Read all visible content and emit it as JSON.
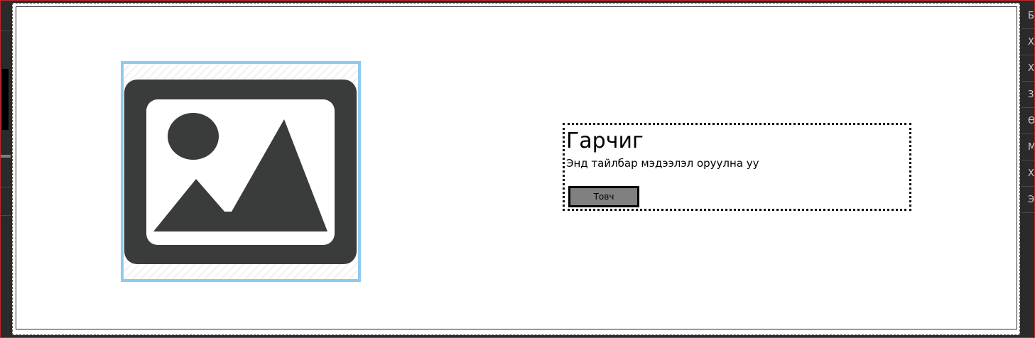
{
  "content": {
    "heading": "Гарчиг",
    "description": "Энд тайлбар мэдээлэл оруулна уу",
    "button_label": "Товч"
  },
  "image_placeholder": {
    "icon": "image-icon"
  },
  "right_panel": {
    "items": [
      "Б",
      "Х",
      "Х",
      "З",
      "Ө",
      "М",
      "Х",
      "Э"
    ]
  },
  "colors": {
    "frame": "#2a2a2a",
    "frame_outline": "#c0262d",
    "image_border": "#8fcaef",
    "icon_fill": "#3a3b3b",
    "button_bg": "#808080"
  }
}
